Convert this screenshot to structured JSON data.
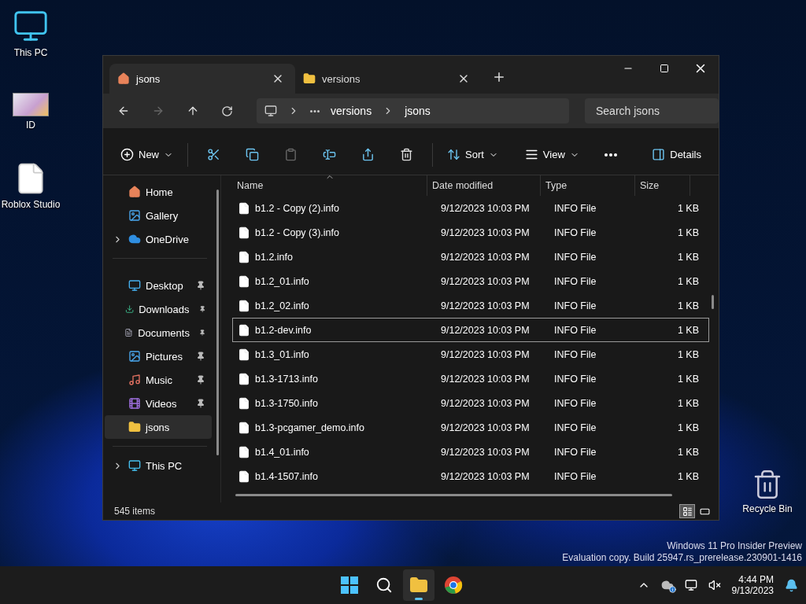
{
  "desktop_icons": [
    {
      "label": "This PC",
      "kind": "pc"
    },
    {
      "label": "ID",
      "kind": "photo"
    },
    {
      "label": "Roblox Studio",
      "kind": "shortcut"
    },
    {
      "label": "Recycle Bin",
      "kind": "recycle"
    }
  ],
  "window": {
    "tabs": [
      {
        "label": "jsons",
        "kind": "home",
        "selected": true
      },
      {
        "label": "versions",
        "kind": "folder",
        "selected": false
      }
    ],
    "breadcrumbs": [
      "versions",
      "jsons"
    ],
    "search": {
      "placeholder": "Search jsons"
    },
    "toolbar": {
      "new": "New",
      "sort": "Sort",
      "view": "View",
      "details": "Details",
      "paste_disabled": true
    },
    "sidebar": [
      [
        {
          "label": "Home",
          "kind": "home",
          "pinned": false,
          "expandable": false,
          "selected": false
        },
        {
          "label": "Gallery",
          "kind": "gallery",
          "pinned": false,
          "expandable": false,
          "selected": false
        },
        {
          "label": "OneDrive",
          "kind": "cloud",
          "pinned": false,
          "expandable": true,
          "selected": false
        }
      ],
      [
        {
          "label": "Desktop",
          "kind": "desktop",
          "pinned": true,
          "expandable": false,
          "selected": false
        },
        {
          "label": "Downloads",
          "kind": "download",
          "pinned": true,
          "expandable": false,
          "selected": false
        },
        {
          "label": "Documents",
          "kind": "document",
          "pinned": true,
          "expandable": false,
          "selected": false
        },
        {
          "label": "Pictures",
          "kind": "gallery",
          "pinned": true,
          "expandable": false,
          "selected": false
        },
        {
          "label": "Music",
          "kind": "music",
          "pinned": true,
          "expandable": false,
          "selected": false
        },
        {
          "label": "Videos",
          "kind": "video",
          "pinned": true,
          "expandable": false,
          "selected": false
        },
        {
          "label": "jsons",
          "kind": "folder",
          "pinned": false,
          "expandable": false,
          "selected": true
        }
      ],
      [
        {
          "label": "This PC",
          "kind": "pc",
          "pinned": false,
          "expandable": true,
          "selected": false
        }
      ]
    ],
    "columns": [
      {
        "label": "Name",
        "sorted": true
      },
      {
        "label": "Date modified",
        "sorted": false
      },
      {
        "label": "Type",
        "sorted": false
      },
      {
        "label": "Size",
        "sorted": false
      }
    ],
    "rows": [
      {
        "name": "b1.2 - Copy (2).info",
        "date": "9/12/2023 10:03 PM",
        "type": "INFO File",
        "size": "1 KB",
        "selected": false
      },
      {
        "name": "b1.2 - Copy (3).info",
        "date": "9/12/2023 10:03 PM",
        "type": "INFO File",
        "size": "1 KB",
        "selected": false
      },
      {
        "name": "b1.2.info",
        "date": "9/12/2023 10:03 PM",
        "type": "INFO File",
        "size": "1 KB",
        "selected": false
      },
      {
        "name": "b1.2_01.info",
        "date": "9/12/2023 10:03 PM",
        "type": "INFO File",
        "size": "1 KB",
        "selected": false
      },
      {
        "name": "b1.2_02.info",
        "date": "9/12/2023 10:03 PM",
        "type": "INFO File",
        "size": "1 KB",
        "selected": false
      },
      {
        "name": "b1.2-dev.info",
        "date": "9/12/2023 10:03 PM",
        "type": "INFO File",
        "size": "1 KB",
        "selected": true
      },
      {
        "name": "b1.3_01.info",
        "date": "9/12/2023 10:03 PM",
        "type": "INFO File",
        "size": "1 KB",
        "selected": false
      },
      {
        "name": "b1.3-1713.info",
        "date": "9/12/2023 10:03 PM",
        "type": "INFO File",
        "size": "1 KB",
        "selected": false
      },
      {
        "name": "b1.3-1750.info",
        "date": "9/12/2023 10:03 PM",
        "type": "INFO File",
        "size": "1 KB",
        "selected": false
      },
      {
        "name": "b1.3-pcgamer_demo.info",
        "date": "9/12/2023 10:03 PM",
        "type": "INFO File",
        "size": "1 KB",
        "selected": false
      },
      {
        "name": "b1.4_01.info",
        "date": "9/12/2023 10:03 PM",
        "type": "INFO File",
        "size": "1 KB",
        "selected": false
      },
      {
        "name": "b1.4-1507.info",
        "date": "9/12/2023 10:03 PM",
        "type": "INFO File",
        "size": "1 KB",
        "selected": false
      }
    ],
    "status": "545 items",
    "view_modes": [
      {
        "kind": "details",
        "selected": true
      },
      {
        "kind": "tiles",
        "selected": false
      }
    ]
  },
  "watermark": [
    "Windows 11 Pro Insider Preview",
    "Evaluation copy. Build 25947.rs_prerelease.230901-1416"
  ],
  "taskbar": {
    "time": "4:44 PM",
    "date": "9/13/2023",
    "apps": [
      {
        "kind": "start",
        "active": false
      },
      {
        "kind": "search",
        "active": false
      },
      {
        "kind": "explorer",
        "active": true
      },
      {
        "kind": "browser",
        "active": false
      }
    ]
  }
}
